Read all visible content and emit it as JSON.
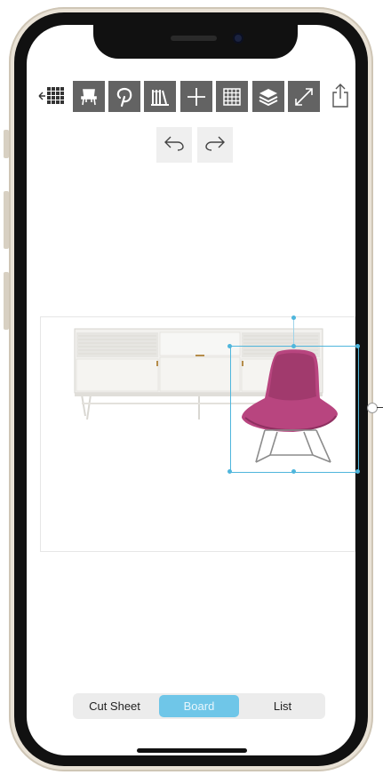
{
  "toolbar": {
    "back_icon": "grid-back-icon",
    "buttons": [
      {
        "name": "chair-icon"
      },
      {
        "name": "pinterest-icon"
      },
      {
        "name": "library-icon"
      },
      {
        "name": "plus-icon"
      },
      {
        "name": "grid-icon"
      },
      {
        "name": "layers-icon"
      },
      {
        "name": "expand-icon"
      }
    ],
    "share_icon": "share-icon",
    "button_color": "#636363"
  },
  "history": {
    "undo_icon": "undo-icon",
    "redo_icon": "redo-icon"
  },
  "board": {
    "items": [
      "credenza-image",
      "chair-image"
    ],
    "selection_color": "#4fb6dc"
  },
  "segmented": {
    "options": [
      {
        "label": "Cut Sheet",
        "active": false
      },
      {
        "label": "Board",
        "active": true
      },
      {
        "label": "List",
        "active": false
      }
    ],
    "active_color": "#6fc6e8"
  }
}
